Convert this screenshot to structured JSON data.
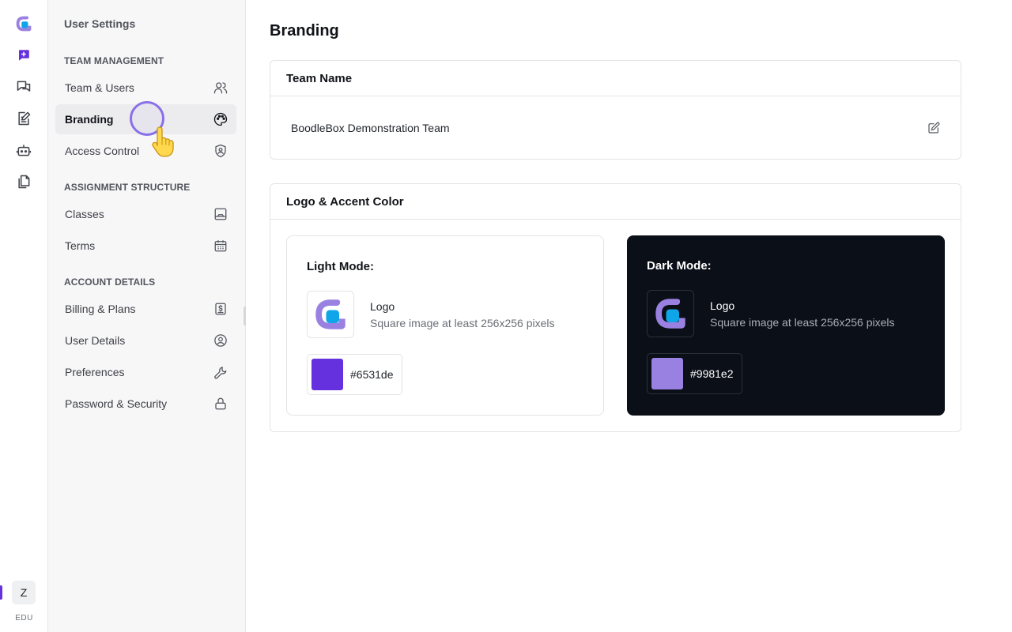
{
  "rail": {
    "items": [
      "app-logo",
      "new-chat",
      "chats",
      "notes",
      "bots",
      "files"
    ],
    "avatar_initial": "Z",
    "plan_badge": "EDU"
  },
  "sidebar": {
    "title": "User Settings",
    "sections": [
      {
        "label": "TEAM MANAGEMENT",
        "items": [
          {
            "label": "Team & Users",
            "icon": "users-icon"
          },
          {
            "label": "Branding",
            "icon": "palette-icon",
            "active": true
          },
          {
            "label": "Access Control",
            "icon": "shield-user-icon"
          }
        ]
      },
      {
        "label": "ASSIGNMENT STRUCTURE",
        "items": [
          {
            "label": "Classes",
            "icon": "presentation-icon"
          },
          {
            "label": "Terms",
            "icon": "calendar-icon"
          }
        ]
      },
      {
        "label": "ACCOUNT DETAILS",
        "items": [
          {
            "label": "Billing & Plans",
            "icon": "dollar-receipt-icon"
          },
          {
            "label": "User Details",
            "icon": "user-circle-icon"
          },
          {
            "label": "Preferences",
            "icon": "wrench-icon"
          },
          {
            "label": "Password & Security",
            "icon": "lock-icon"
          }
        ]
      }
    ]
  },
  "main": {
    "title": "Branding",
    "team_name_card": {
      "header": "Team Name",
      "value": "BoodleBox Demonstration Team"
    },
    "logo_card": {
      "header": "Logo & Accent Color",
      "light": {
        "title": "Light Mode:",
        "logo_label": "Logo",
        "logo_hint": "Square image at least 256x256 pixels",
        "accent_hex": "#6531de"
      },
      "dark": {
        "title": "Dark Mode:",
        "logo_label": "Logo",
        "logo_hint": "Square image at least 256x256 pixels",
        "accent_hex": "#9981e2"
      }
    }
  },
  "colors": {
    "brand": "#6531de",
    "brand_light": "#9981e2",
    "logo_blue": "#0ea5e9",
    "dark_panel": "#0b0f17"
  }
}
